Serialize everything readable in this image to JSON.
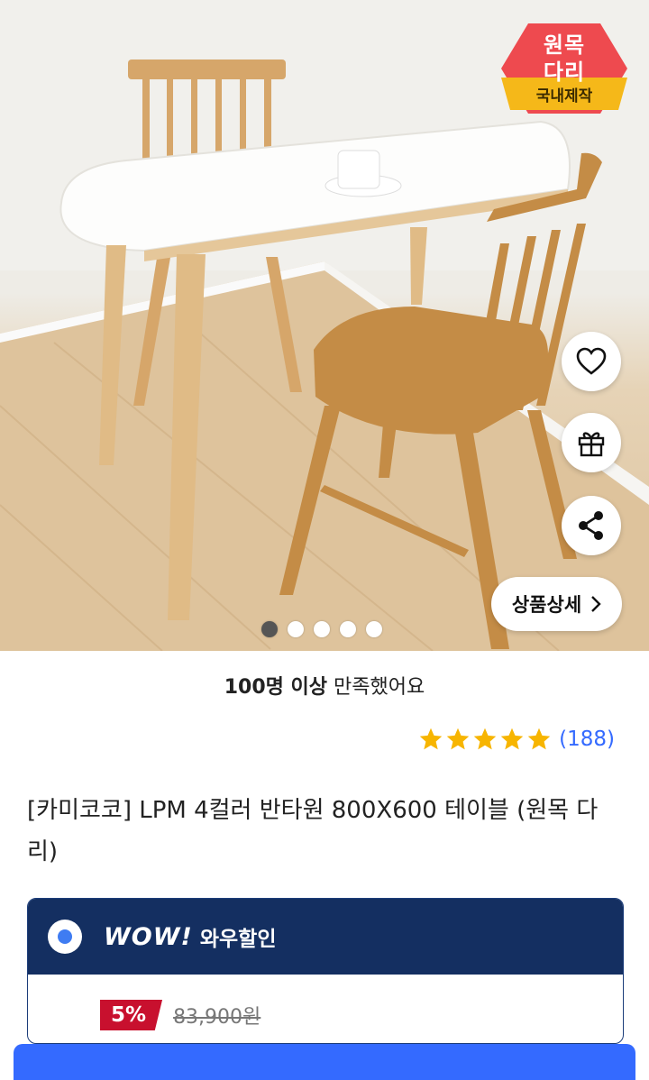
{
  "hero": {
    "badge": {
      "line1": "원목",
      "line2": "다리",
      "ribbon": "국내제작"
    },
    "fab_buttons": [
      "heart-icon",
      "gift-icon",
      "share-icon"
    ],
    "detail_button": {
      "label": "상품상세",
      "icon": "chevron-right-icon"
    },
    "carousel": {
      "total": 5,
      "active": 1
    }
  },
  "satisfaction": {
    "bold": "100명 이상",
    "rest": " 만족했어요"
  },
  "rating": {
    "stars": 5,
    "max": 5,
    "count": "(188)",
    "star_color": "#f7b500",
    "count_color": "#346aff"
  },
  "product": {
    "title": "[카미코코] LPM 4컬러 반타원 800X600 테이블 (원목 다리)"
  },
  "wow": {
    "logo": "WOW!",
    "label": "와우할인",
    "header_color": "#142f61"
  },
  "price": {
    "discount": "5%",
    "original": "83,900원",
    "discount_color": "#c8102e"
  },
  "colors": {
    "accent": "#346aff"
  }
}
